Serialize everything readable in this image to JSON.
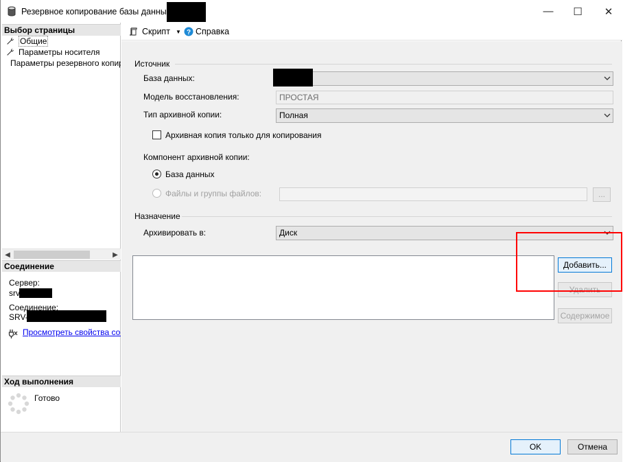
{
  "window": {
    "title": "Резервное копирование базы данных -",
    "minimize": "—",
    "maximize": "☐",
    "close": "✕"
  },
  "sidebar": {
    "header": "Выбор страницы",
    "items": [
      {
        "label": "Общие",
        "icon": "wrench-icon",
        "selected": true
      },
      {
        "label": "Параметры носителя",
        "icon": "wrench-icon"
      },
      {
        "label": "Параметры резервного копир",
        "icon": "wrench-icon"
      }
    ]
  },
  "connection": {
    "header": "Соединение",
    "server_label": "Сервер:",
    "server_value": "srv-",
    "connection_label": "Соединение:",
    "connection_value": "SRV-",
    "properties_link": "Просмотреть свойства соед"
  },
  "progress": {
    "header": "Ход выполнения",
    "status": "Готово"
  },
  "toolbar": {
    "script_label": "Скрипт",
    "help_label": "Справка"
  },
  "source": {
    "group_title": "Источник",
    "database_label": "База данных:",
    "database_value": "",
    "recovery_model_label": "Модель восстановления:",
    "recovery_model_value": "ПРОСТАЯ",
    "backup_type_label": "Тип архивной копии:",
    "backup_type_value": "Полная",
    "copy_only_label": "Архивная копия только для копирования",
    "component_label": "Компонент архивной копии:",
    "component_database": "База данных",
    "component_files": "Файлы и группы файлов:",
    "browse_label": "..."
  },
  "destination": {
    "group_title": "Назначение",
    "backup_to_label": "Архивировать в:",
    "backup_to_value": "Диск",
    "add_button": "Добавить...",
    "remove_button": "Удалить",
    "contents_button": "Содержимое"
  },
  "footer": {
    "ok_button": "OK",
    "cancel_button": "Отмена"
  },
  "colors": {
    "highlight": "#ff0000",
    "link": "#0000ee",
    "primary_border": "#0078d7"
  }
}
